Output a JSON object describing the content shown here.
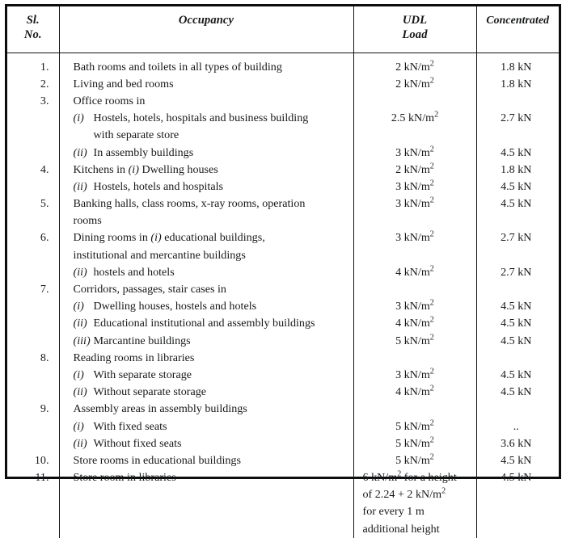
{
  "table": {
    "headers": {
      "sl_no_line1": "Sl.",
      "sl_no_line2": "No.",
      "occupancy": "Occupancy",
      "udl_line1": "UDL",
      "udl_line2": "Load",
      "concentrated": "Concentrated"
    },
    "rows": [
      {
        "sl_no": "1.",
        "occupancy_lines": [
          {
            "text": "Bath rooms and toilets in all types of building",
            "kind": "main"
          }
        ],
        "udl_lines": [
          {
            "value": "2 kN/m",
            "sup": "2"
          }
        ],
        "concentrated_lines": [
          {
            "value": "1.8 kN"
          }
        ]
      },
      {
        "sl_no": "2.",
        "occupancy_lines": [
          {
            "text": "Living and bed rooms",
            "kind": "main"
          }
        ],
        "udl_lines": [
          {
            "value": "2 kN/m",
            "sup": "2"
          }
        ],
        "concentrated_lines": [
          {
            "value": "1.8 kN"
          }
        ]
      },
      {
        "sl_no": "3.",
        "occupancy_lines": [
          {
            "text": "Office rooms in",
            "kind": "main"
          },
          {
            "marker": "(i)",
            "text": "Hostels, hotels, hospitals and business building",
            "kind": "sub"
          },
          {
            "text": "with separate store",
            "kind": "cont"
          },
          {
            "marker": "(ii)",
            "text": "In assembly buildings",
            "kind": "sub"
          }
        ],
        "udl_lines": [
          {
            "value": "",
            "blank": true
          },
          {
            "value": "2.5 kN/m",
            "sup": "2"
          },
          {
            "value": "",
            "blank": true
          },
          {
            "value": "3 kN/m",
            "sup": "2"
          }
        ],
        "concentrated_lines": [
          {
            "value": "",
            "blank": true
          },
          {
            "value": "2.7 kN"
          },
          {
            "value": "",
            "blank": true
          },
          {
            "value": "4.5 kN"
          }
        ]
      },
      {
        "sl_no": "4.",
        "occupancy_lines": [
          {
            "marker": "",
            "text": "Kitchens in (i) Dwelling houses",
            "kind": "main"
          },
          {
            "marker": "(ii)",
            "text": "Hostels, hotels and hospitals",
            "kind": "sub"
          }
        ],
        "udl_lines": [
          {
            "value": "2 kN/m",
            "sup": "2"
          },
          {
            "value": "3 kN/m",
            "sup": "2"
          }
        ],
        "concentrated_lines": [
          {
            "value": "1.8 kN"
          },
          {
            "value": "4.5 kN"
          }
        ]
      },
      {
        "sl_no": "5.",
        "occupancy_lines": [
          {
            "text": "Banking halls, class rooms, x-ray rooms, operation",
            "kind": "main"
          },
          {
            "text": "rooms",
            "kind": "wrap"
          }
        ],
        "udl_lines": [
          {
            "value": "3 kN/m",
            "sup": "2"
          },
          {
            "value": "",
            "blank": true
          }
        ],
        "concentrated_lines": [
          {
            "value": "4.5 kN"
          },
          {
            "value": "",
            "blank": true
          }
        ]
      },
      {
        "sl_no": "6.",
        "occupancy_lines": [
          {
            "text": "Dining rooms in (i) educational buildings,",
            "kind": "main"
          },
          {
            "text": "institutional and mercantine buildings",
            "kind": "wrap"
          },
          {
            "marker": "(ii)",
            "text": "hostels and hotels",
            "kind": "sub"
          }
        ],
        "udl_lines": [
          {
            "value": "3 kN/m",
            "sup": "2"
          },
          {
            "value": "",
            "blank": true
          },
          {
            "value": "4 kN/m",
            "sup": "2"
          }
        ],
        "concentrated_lines": [
          {
            "value": "2.7 kN"
          },
          {
            "value": "",
            "blank": true
          },
          {
            "value": "2.7 kN"
          }
        ]
      },
      {
        "sl_no": "7.",
        "occupancy_lines": [
          {
            "text": "Corridors, passages, stair cases in",
            "kind": "main"
          },
          {
            "marker": "(i)",
            "text": "Dwelling houses, hostels and hotels",
            "kind": "sub"
          },
          {
            "marker": "(ii)",
            "text": "Educational institutional and assembly buildings",
            "kind": "sub"
          },
          {
            "marker": "(iii)",
            "text": "Marcantine buildings",
            "kind": "sub"
          }
        ],
        "udl_lines": [
          {
            "value": "",
            "blank": true
          },
          {
            "value": "3 kN/m",
            "sup": "2"
          },
          {
            "value": "4 kN/m",
            "sup": "2"
          },
          {
            "value": "5 kN/m",
            "sup": "2"
          }
        ],
        "concentrated_lines": [
          {
            "value": "",
            "blank": true
          },
          {
            "value": "4.5 kN"
          },
          {
            "value": "4.5 kN"
          },
          {
            "value": "4.5 kN"
          }
        ]
      },
      {
        "sl_no": "8.",
        "occupancy_lines": [
          {
            "text": "Reading rooms in libraries",
            "kind": "main"
          },
          {
            "marker": "(i)",
            "text": "With separate storage",
            "kind": "sub"
          },
          {
            "marker": "(ii)",
            "text": "Without separate storage",
            "kind": "sub"
          }
        ],
        "udl_lines": [
          {
            "value": "",
            "blank": true
          },
          {
            "value": "3 kN/m",
            "sup": "2"
          },
          {
            "value": "4 kN/m",
            "sup": "2"
          }
        ],
        "concentrated_lines": [
          {
            "value": "",
            "blank": true
          },
          {
            "value": "4.5 kN"
          },
          {
            "value": "4.5 kN"
          }
        ]
      },
      {
        "sl_no": "9.",
        "occupancy_lines": [
          {
            "text": "Assembly areas in assembly buildings",
            "kind": "main"
          },
          {
            "marker": "(i)",
            "text": "With fixed seats",
            "kind": "sub"
          },
          {
            "marker": "(ii)",
            "text": "Without fixed seats",
            "kind": "sub"
          }
        ],
        "udl_lines": [
          {
            "value": "",
            "blank": true
          },
          {
            "value": "5 kN/m",
            "sup": "2"
          },
          {
            "value": "5 kN/m",
            "sup": "2"
          }
        ],
        "concentrated_lines": [
          {
            "value": "",
            "blank": true
          },
          {
            "value": ".."
          },
          {
            "value": "3.6 kN"
          }
        ]
      },
      {
        "sl_no": "10.",
        "occupancy_lines": [
          {
            "text": "Store rooms in educational buildings",
            "kind": "main"
          }
        ],
        "udl_lines": [
          {
            "value": "5 kN/m",
            "sup": "2"
          }
        ],
        "concentrated_lines": [
          {
            "value": "4.5 kN"
          }
        ]
      },
      {
        "sl_no": "11.",
        "occupancy_lines": [
          {
            "text": "Store room in libraries",
            "kind": "main"
          }
        ],
        "udl_lines": [
          {
            "value": "6 kN/m",
            "sup": "2",
            "tail": " for a height"
          },
          {
            "value": "of 2.24 + 2 kN/m",
            "sup": "2"
          },
          {
            "value": "for every 1 m"
          },
          {
            "value": "additional height"
          }
        ],
        "udl_align": "left",
        "concentrated_lines": [
          {
            "value": "4.5 kN"
          }
        ]
      }
    ]
  }
}
